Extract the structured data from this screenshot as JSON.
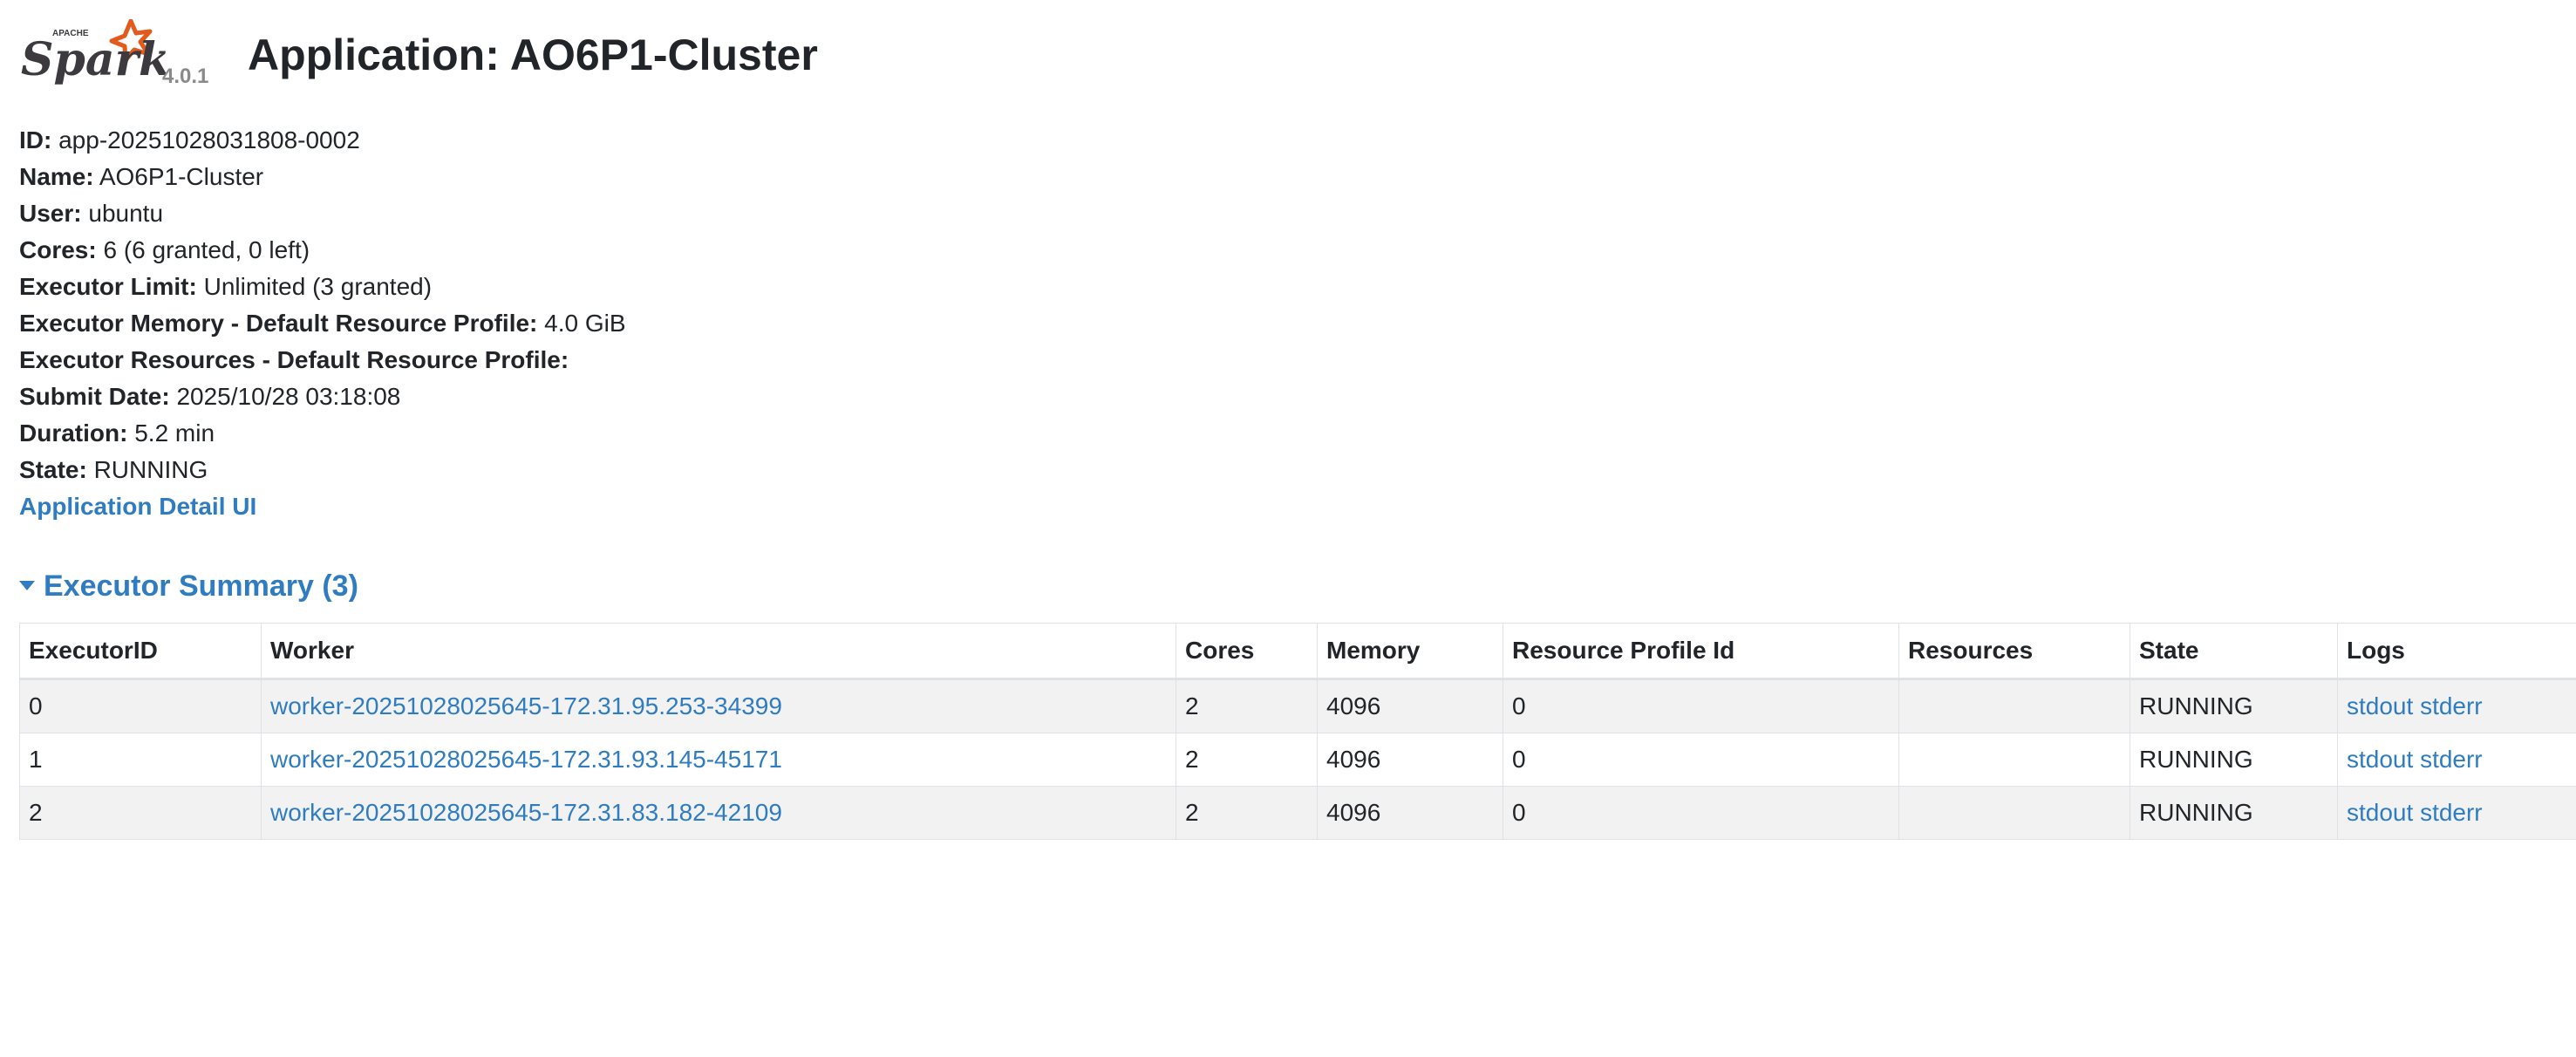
{
  "header": {
    "logo_text": "Spark",
    "logo_sup": "APACHE",
    "version": "4.0.1",
    "title": "Application: AO6P1-Cluster"
  },
  "info": [
    {
      "label": "ID:",
      "value": " app-20251028031808-0002"
    },
    {
      "label": "Name:",
      "value": " AO6P1-Cluster"
    },
    {
      "label": "User:",
      "value": " ubuntu"
    },
    {
      "label": "Cores:",
      "value": " 6 (6 granted, 0 left)"
    },
    {
      "label": "Executor Limit:",
      "value": " Unlimited (3 granted)"
    },
    {
      "label": "Executor Memory - Default Resource Profile:",
      "value": " 4.0 GiB"
    },
    {
      "label": "Executor Resources - Default Resource Profile:",
      "value": ""
    },
    {
      "label": "Submit Date:",
      "value": " 2025/10/28 03:18:08"
    },
    {
      "label": "Duration:",
      "value": " 5.2 min"
    },
    {
      "label": "State:",
      "value": " RUNNING"
    }
  ],
  "detail_link": "Application Detail UI",
  "executor_summary": {
    "title": "Executor Summary (3)",
    "columns": [
      "ExecutorID",
      "Worker",
      "Cores",
      "Memory",
      "Resource Profile Id",
      "Resources",
      "State",
      "Logs"
    ],
    "rows": [
      {
        "id": "0",
        "worker": "worker-20251028025645-172.31.95.253-34399",
        "cores": "2",
        "memory": "4096",
        "profile": "0",
        "resources": "",
        "state": "RUNNING",
        "stdout": "stdout",
        "stderr": "stderr"
      },
      {
        "id": "1",
        "worker": "worker-20251028025645-172.31.93.145-45171",
        "cores": "2",
        "memory": "4096",
        "profile": "0",
        "resources": "",
        "state": "RUNNING",
        "stdout": "stdout",
        "stderr": "stderr"
      },
      {
        "id": "2",
        "worker": "worker-20251028025645-172.31.83.182-42109",
        "cores": "2",
        "memory": "4096",
        "profile": "0",
        "resources": "",
        "state": "RUNNING",
        "stdout": "stdout",
        "stderr": "stderr"
      }
    ]
  },
  "colors": {
    "link": "#2f7cc1",
    "logo_orange": "#e25a1c",
    "logo_text": "#3c3a3e"
  }
}
